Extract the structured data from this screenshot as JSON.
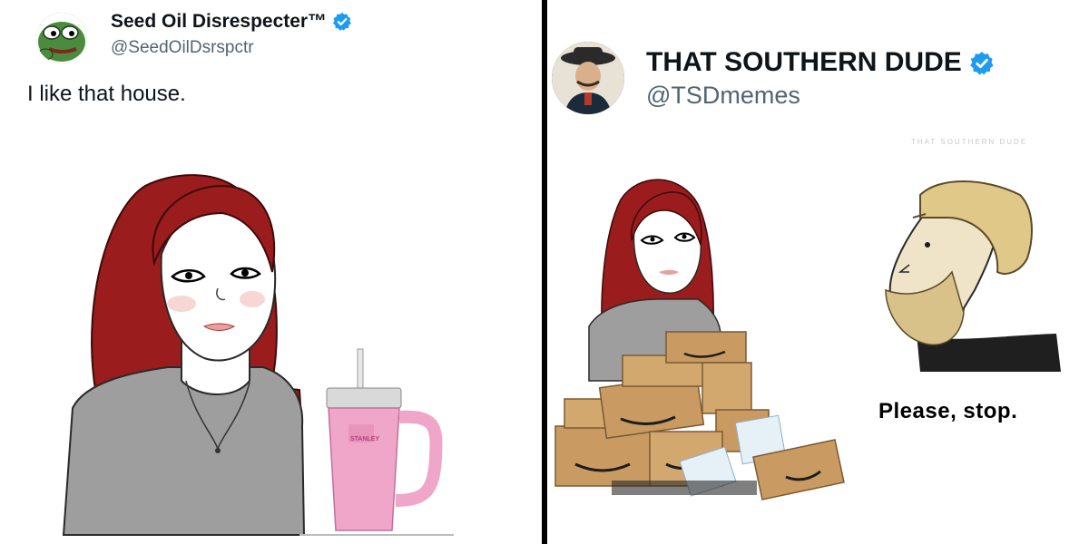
{
  "left_tweet": {
    "display_name": "Seed Oil Disrespecter™",
    "handle": "@SeedOilDsrspctr",
    "text": "I like that house.",
    "avatar_icon": "pepe-frog-avatar",
    "verified_icon": "verified-badge-icon",
    "cup_brand": "STANLEY"
  },
  "right_tweet": {
    "display_name": "THAT SOUTHERN DUDE",
    "handle": "@TSDmemes",
    "watermark": "THAT SOUTHERN DUDE",
    "caption": "Please, stop.",
    "avatar_icon": "cowboy-portrait-avatar",
    "verified_icon": "verified-badge-icon"
  },
  "colors": {
    "verified_blue": "#1d9bf0",
    "hair_red": "#9a1c1c",
    "shirt_gray": "#9a9a9a",
    "cup_pink": "#f0a6c8",
    "box_brown": "#c99a62"
  }
}
